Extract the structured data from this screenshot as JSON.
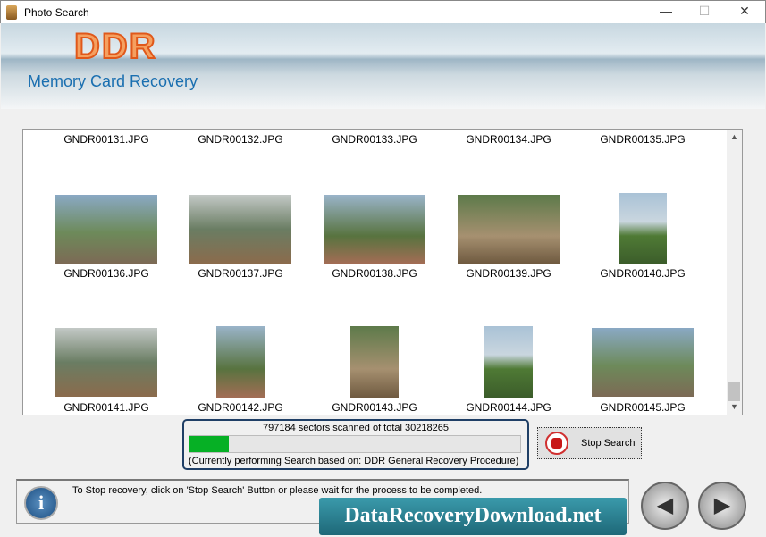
{
  "window": {
    "title": "Photo Search",
    "minimize": "—",
    "maximize": "☐",
    "close": "✕"
  },
  "banner": {
    "logo": "DDR",
    "subtitle": "Memory Card Recovery"
  },
  "gallery": {
    "rows": [
      [
        "GNDR00131.JPG",
        "GNDR00132.JPG",
        "GNDR00133.JPG",
        "GNDR00134.JPG",
        "GNDR00135.JPG"
      ],
      [
        "GNDR00136.JPG",
        "GNDR00137.JPG",
        "GNDR00138.JPG",
        "GNDR00139.JPG",
        "GNDR00140.JPG"
      ],
      [
        "GNDR00141.JPG",
        "GNDR00142.JPG",
        "GNDR00143.JPG",
        "GNDR00144.JPG",
        "GNDR00145.JPG"
      ]
    ]
  },
  "progress": {
    "status": "797184 sectors scanned of total 30218265",
    "procedure": "(Currently performing Search based on:  DDR General Recovery Procedure)",
    "percent": 12,
    "color": "#06b025"
  },
  "stop_button": {
    "label": "Stop Search"
  },
  "statusbar": {
    "message": "To Stop recovery, click on 'Stop Search' Button or please wait for the process to be completed.",
    "info_icon": "i"
  },
  "brand": {
    "text": "DataRecoveryDownload.net"
  },
  "nav": {
    "back": "◀",
    "next": "▶"
  }
}
